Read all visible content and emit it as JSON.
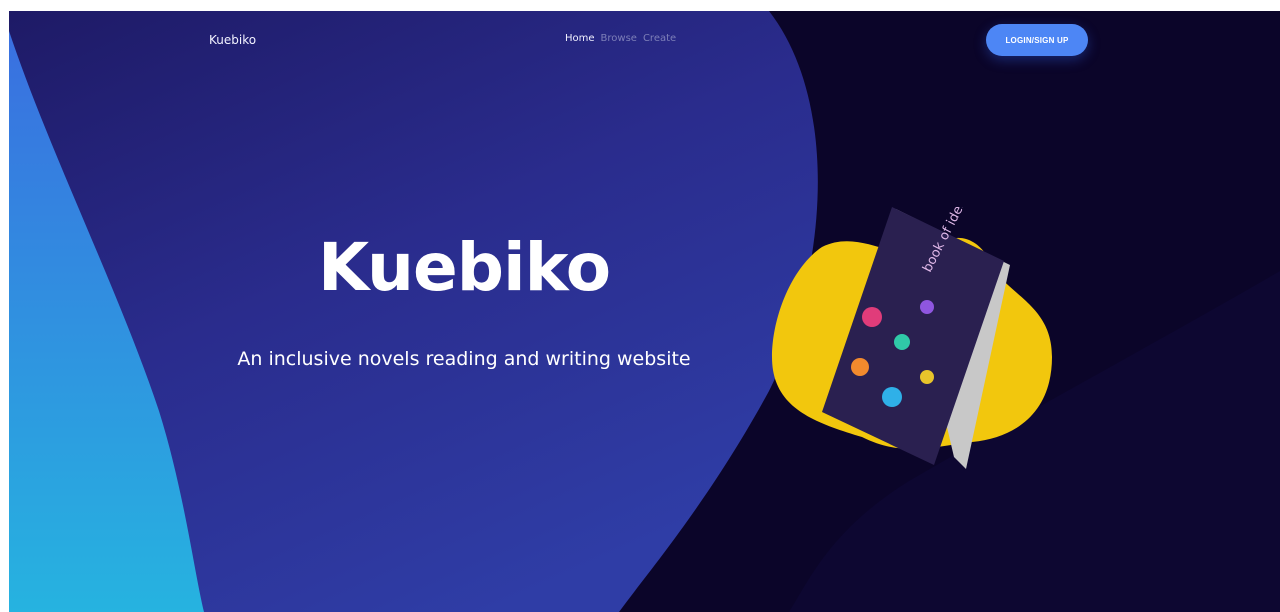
{
  "nav": {
    "brand": "Kuebiko",
    "links": [
      {
        "label": "Home",
        "active": true
      },
      {
        "label": "Browse",
        "active": false
      },
      {
        "label": "Create",
        "active": false
      }
    ],
    "login_label": "LOGIN/SIGN UP"
  },
  "hero": {
    "title": "Kuebiko",
    "subtitle": "An inclusive novels reading and writing website"
  },
  "book": {
    "cover_text": "book of ideas"
  },
  "colors": {
    "background": "#0b0529",
    "wave": "#2c2c8f",
    "accent": "#4d86f5",
    "blob": "#f2c70d",
    "book_cover": "#2a2050"
  }
}
